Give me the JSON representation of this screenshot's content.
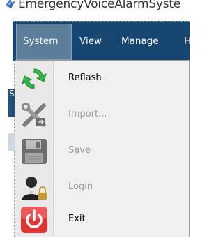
{
  "window": {
    "title": "EmergencyVoiceAlarmSyste",
    "app_icon": "app-icon"
  },
  "menubar": {
    "items": [
      {
        "label": "System",
        "active": true
      },
      {
        "label": "View",
        "active": false
      },
      {
        "label": "Manage",
        "active": false
      },
      {
        "label": "H",
        "active": false
      }
    ]
  },
  "dropdown": {
    "items": [
      {
        "label": "Reflash",
        "icon": "refresh-icon",
        "enabled": true
      },
      {
        "label": "Import...",
        "icon": "tools-icon",
        "enabled": false
      },
      {
        "label": "Save",
        "icon": "floppy-disk-icon",
        "enabled": false
      },
      {
        "label": "Login",
        "icon": "user-lock-icon",
        "enabled": false
      },
      {
        "label": "Exit",
        "icon": "power-icon",
        "enabled": true
      }
    ]
  },
  "background": {
    "partial_letter": "S"
  },
  "colors": {
    "menubar_bg": "#16466f",
    "menu_active_bg": "#5d7e9b",
    "dropdown_bg": "#f0f0f0",
    "disabled_text": "#9a9a9a",
    "exit_red": "#e03434",
    "refresh_green": "#35b544"
  }
}
